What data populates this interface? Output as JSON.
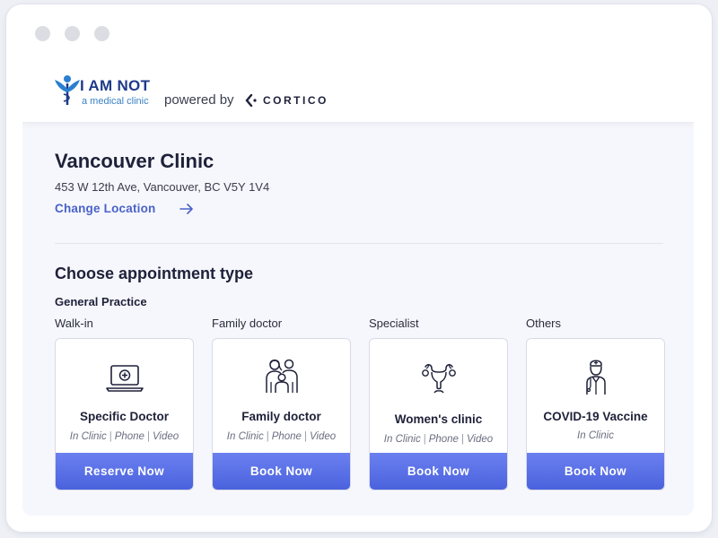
{
  "brand": {
    "title": "I AM NOT",
    "subtitle": "a medical clinic",
    "powered_by": "powered by",
    "partner": "CORTICO"
  },
  "clinic": {
    "name": "Vancouver Clinic",
    "address": "453 W 12th Ave, Vancouver, BC V5Y 1V4",
    "change_location": "Change Location"
  },
  "appointments": {
    "section_title": "Choose appointment type",
    "group_title": "General Practice",
    "columns": [
      {
        "label": "Walk-in",
        "icon": "laptop-plus-icon",
        "title": "Specific Doctor",
        "modes": [
          "In Clinic",
          "Phone",
          "Video"
        ],
        "button": "Reserve Now"
      },
      {
        "label": "Family doctor",
        "icon": "family-icon",
        "title": "Family doctor",
        "modes": [
          "In Clinic",
          "Phone",
          "Video"
        ],
        "button": "Book Now"
      },
      {
        "label": "Specialist",
        "icon": "uterus-icon",
        "title": "Women's clinic",
        "modes": [
          "In Clinic",
          "Phone",
          "Video"
        ],
        "button": "Book Now"
      },
      {
        "label": "Others",
        "icon": "doctor-icon",
        "title": "COVID-19 Vaccine",
        "modes": [
          "In Clinic"
        ],
        "button": "Book Now"
      }
    ]
  },
  "colors": {
    "accent": "#4a62dd",
    "link": "#4a62c9",
    "brand": "#1e3a8a"
  }
}
